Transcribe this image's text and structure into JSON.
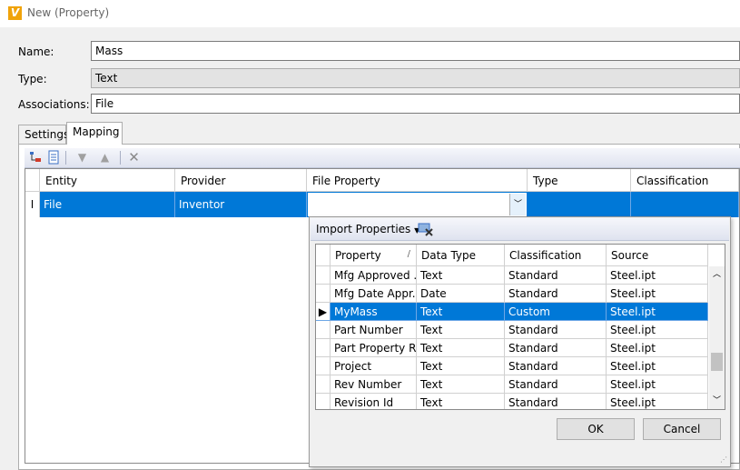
{
  "window": {
    "title": "New (Property)",
    "icon_letter": "V"
  },
  "form": {
    "name_label": "Name:",
    "name_value": "Mass",
    "type_label": "Type:",
    "type_value": "Text",
    "assoc_label": "Associations:",
    "assoc_value": "File"
  },
  "tabs": [
    {
      "label": "Settings"
    },
    {
      "label": "Mapping"
    }
  ],
  "mapping_grid": {
    "headers": [
      "Entity",
      "Provider",
      "File Property",
      "Type",
      "Classification"
    ],
    "row": {
      "entity": "File",
      "provider": "Inventor",
      "file_property": "",
      "type": "",
      "classification": ""
    }
  },
  "dropdown": {
    "import_label": "Import Properties",
    "headers": [
      "Property",
      "Data Type",
      "Classification",
      "Source"
    ],
    "rows": [
      {
        "property": "Mfg Approved ...",
        "data_type": "Text",
        "classification": "Standard",
        "source": "Steel.ipt"
      },
      {
        "property": "Mfg Date Appr...",
        "data_type": "Date",
        "classification": "Standard",
        "source": "Steel.ipt"
      },
      {
        "property": "MyMass",
        "data_type": "Text",
        "classification": "Custom",
        "source": "Steel.ipt"
      },
      {
        "property": "Part Number",
        "data_type": "Text",
        "classification": "Standard",
        "source": "Steel.ipt"
      },
      {
        "property": "Part Property R...",
        "data_type": "Text",
        "classification": "Standard",
        "source": "Steel.ipt"
      },
      {
        "property": "Project",
        "data_type": "Text",
        "classification": "Standard",
        "source": "Steel.ipt"
      },
      {
        "property": "Rev Number",
        "data_type": "Text",
        "classification": "Standard",
        "source": "Steel.ipt"
      },
      {
        "property": "Revision Id",
        "data_type": "Text",
        "classification": "Standard",
        "source": "Steel.ipt"
      }
    ],
    "ok_label": "OK",
    "cancel_label": "Cancel"
  },
  "colors": {
    "selection": "#0078d7",
    "app_icon": "#f0a30a"
  }
}
